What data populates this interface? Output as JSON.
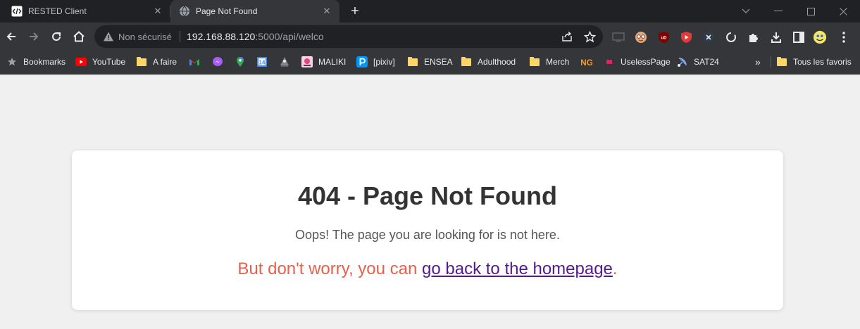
{
  "tabs": [
    {
      "title": "RESTED Client",
      "icon": "code-icon",
      "active": false
    },
    {
      "title": "Page Not Found",
      "icon": "globe-icon",
      "active": true
    }
  ],
  "omnibox": {
    "security": "Non sécurisé",
    "host": "192.168.88.120",
    "path": ":5000/api/welco"
  },
  "bookmarks": [
    {
      "label": "Bookmarks",
      "icon": "star-icon"
    },
    {
      "label": "YouTube",
      "icon": "youtube-icon"
    },
    {
      "label": "A faire",
      "icon": "folder-icon"
    },
    {
      "label": "",
      "icon": "gmail-icon"
    },
    {
      "label": "",
      "icon": "messenger-icon"
    },
    {
      "label": "",
      "icon": "maps-icon"
    },
    {
      "label": "",
      "icon": "calendar-icon"
    },
    {
      "label": "",
      "icon": "app-icon"
    },
    {
      "label": "MALIKI",
      "icon": "maliki-icon"
    },
    {
      "label": "[pixiv]",
      "icon": "pixiv-icon"
    },
    {
      "label": "ENSEA",
      "icon": "folder-icon"
    },
    {
      "label": "Adulthood",
      "icon": "folder-icon"
    },
    {
      "label": "Merch",
      "icon": "folder-icon"
    },
    {
      "label": "",
      "icon": "newgrounds-icon"
    },
    {
      "label": "UselessPage",
      "icon": "useless-icon"
    },
    {
      "label": "SAT24",
      "icon": "sat24-icon"
    },
    {
      "label": "Tous les favoris",
      "icon": "folder-icon"
    }
  ],
  "calendar_day": "14",
  "newgrounds_text": "NG",
  "overflow": "»",
  "content": {
    "heading": "404 - Page Not Found",
    "message": "Oops! The page you are looking for is not here.",
    "worry_prefix": "But don't worry, you can ",
    "link_text": "go back to the homepage",
    "worry_suffix": "."
  },
  "colors": {
    "heading": "#333333",
    "message": "#555555",
    "worry": "#e8604c",
    "link": "#551a8b"
  }
}
